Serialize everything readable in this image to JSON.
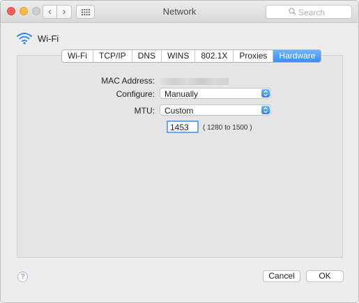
{
  "window": {
    "title": "Network",
    "search_placeholder": "Search"
  },
  "interface": {
    "name": "Wi-Fi",
    "icon": "wifi-icon"
  },
  "tabs": [
    {
      "label": "Wi-Fi",
      "active": false
    },
    {
      "label": "TCP/IP",
      "active": false
    },
    {
      "label": "DNS",
      "active": false
    },
    {
      "label": "WINS",
      "active": false
    },
    {
      "label": "802.1X",
      "active": false
    },
    {
      "label": "Proxies",
      "active": false
    },
    {
      "label": "Hardware",
      "active": true
    }
  ],
  "hardware": {
    "mac_label": "MAC Address:",
    "configure_label": "Configure:",
    "configure_value": "Manually",
    "mtu_label": "MTU:",
    "mtu_value": "Custom",
    "mtu_input": "1453",
    "mtu_range": "( 1280 to 1500 )"
  },
  "buttons": {
    "help": "?",
    "cancel": "Cancel",
    "ok": "OK"
  },
  "colors": {
    "accent": "#3d8ef5",
    "focus_ring": "#6aa5f0"
  }
}
